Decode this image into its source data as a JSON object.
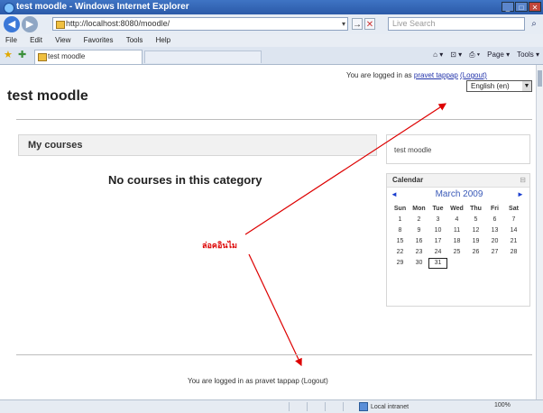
{
  "window": {
    "title": "test moodle - Windows Internet Explorer",
    "buttons": [
      "_",
      "□",
      "✕"
    ]
  },
  "nav": {
    "back": "◀",
    "forward": "▶",
    "address": "http://localhost:8080/moodle/",
    "go": "→",
    "stop": "✕",
    "search_placeholder": "Live Search",
    "search_icon": "⌕"
  },
  "menu": [
    "File",
    "Edit",
    "View",
    "Favorites",
    "Tools",
    "Help"
  ],
  "tab": {
    "label": "test moodle"
  },
  "command_bar": [
    "⌂ ▾",
    "⊡ ▾",
    "⎙ ▾",
    "Page ▾",
    "Tools ▾"
  ],
  "page": {
    "site_title": "test moodle",
    "login_prefix": "You are logged in as ",
    "login_user": "pravet tappap",
    "login_logout": "(Logout)",
    "language": "English (en)",
    "courses_heading": "My courses",
    "no_courses": "No courses in this category",
    "site_block": "test moodle",
    "annotation": "ล่อคอินไม",
    "footer_login": "You are logged in as pravet tappap (Logout)"
  },
  "calendar": {
    "title": "Calendar",
    "month": "March 2009",
    "prev": "◄",
    "next": "►",
    "days": [
      "Sun",
      "Mon",
      "Tue",
      "Wed",
      "Thu",
      "Fri",
      "Sat"
    ],
    "dates": [
      "1",
      "2",
      "3",
      "4",
      "5",
      "6",
      "7",
      "8",
      "9",
      "10",
      "11",
      "12",
      "13",
      "14",
      "15",
      "16",
      "17",
      "18",
      "19",
      "20",
      "21",
      "22",
      "23",
      "24",
      "25",
      "26",
      "27",
      "28",
      "29",
      "30",
      "31"
    ],
    "today": "31"
  },
  "status": {
    "zone": "Local intranet",
    "zoom": "100%"
  },
  "colors": {
    "accent": "#3b78d8",
    "annotation": "#dd0000",
    "link": "#2233aa"
  }
}
